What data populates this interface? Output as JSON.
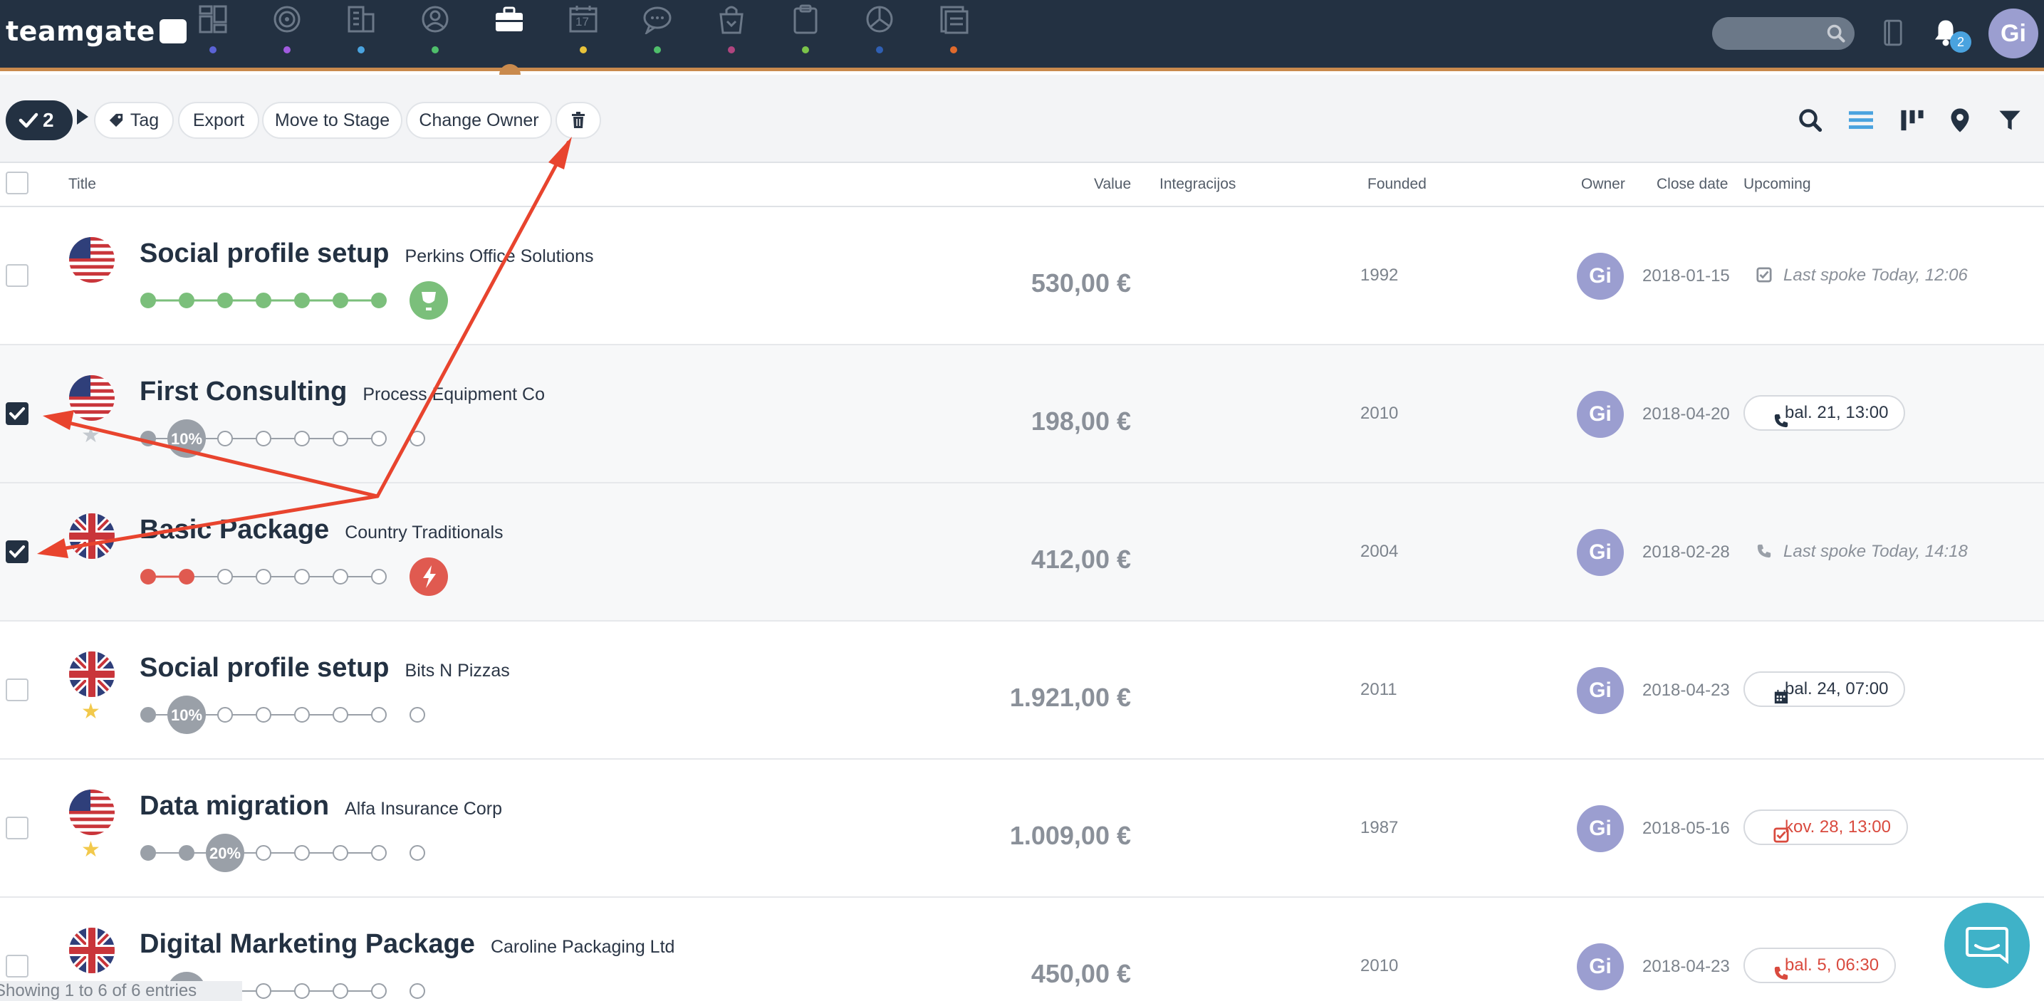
{
  "brand": {
    "logo_text": "teamgate",
    "accent_color": "#c98a4d",
    "nav_bg": "#233142"
  },
  "nav": {
    "items": [
      {
        "name": "dashboard-icon",
        "dot_color": "#5b63d6"
      },
      {
        "name": "target-icon",
        "dot_color": "#a15be0"
      },
      {
        "name": "companies-icon",
        "dot_color": "#4aa3df"
      },
      {
        "name": "people-icon",
        "dot_color": "#4fbf6b"
      },
      {
        "name": "deals-icon",
        "dot_color": "#c98a4d",
        "active": true
      },
      {
        "name": "calendar-icon",
        "dot_color": "#e8c33a"
      },
      {
        "name": "chat-icon",
        "dot_color": "#4fbf6b"
      },
      {
        "name": "shopping-bag-icon",
        "dot_color": "#b0457f"
      },
      {
        "name": "clipboard-icon",
        "dot_color": "#7bc44a"
      },
      {
        "name": "pie-chart-icon",
        "dot_color": "#2f5fb3"
      },
      {
        "name": "reports-icon",
        "dot_color": "#e06a2c"
      }
    ],
    "calendar_day": "17",
    "notification_count": "2",
    "user_initials": "Gi"
  },
  "toolbar": {
    "selected_count": "2",
    "tag_label": "Tag",
    "export_label": "Export",
    "move_label": "Move to Stage",
    "owner_label": "Change Owner"
  },
  "columns": {
    "title": "Title",
    "value": "Value",
    "integrations": "Integracijos",
    "founded": "Founded",
    "owner": "Owner",
    "close_date": "Close date",
    "upcoming": "Upcoming"
  },
  "rows": [
    {
      "title": "Social profile setup",
      "company": "Perkins Office Solutions",
      "value": "530,00 €",
      "founded": "1992",
      "owner": "Gi",
      "close_date": "2018-01-15",
      "upcoming": "Last spoke Today, 12:06",
      "upcoming_type": "task-text",
      "flag": "us",
      "checked": false,
      "star": "none",
      "pipeline": {
        "filled": 7,
        "won": true,
        "color": "#7bbf7b"
      }
    },
    {
      "title": "First Consulting",
      "company": "Process Equipment Co",
      "value": "198,00 €",
      "founded": "2010",
      "owner": "Gi",
      "close_date": "2018-04-20",
      "upcoming": "bal. 21, 13:00",
      "upcoming_type": "call",
      "flag": "us",
      "checked": true,
      "star": "grey",
      "pipeline": {
        "stage": 1,
        "percent": "10%"
      }
    },
    {
      "title": "Basic Package",
      "company": "Country Traditionals",
      "value": "412,00 €",
      "founded": "2004",
      "owner": "Gi",
      "close_date": "2018-02-28",
      "upcoming": "Last spoke Today, 14:18",
      "upcoming_type": "call-text",
      "flag": "uk",
      "checked": true,
      "star": "none",
      "pipeline": {
        "filled": 2,
        "lost": true,
        "color": "#e05a50"
      }
    },
    {
      "title": "Social profile setup",
      "company": "Bits N Pizzas",
      "value": "1.921,00 €",
      "founded": "2011",
      "owner": "Gi",
      "close_date": "2018-04-23",
      "upcoming": "bal. 24, 07:00",
      "upcoming_type": "meeting",
      "flag": "uk",
      "checked": false,
      "star": "gold",
      "pipeline": {
        "stage": 1,
        "percent": "10%"
      }
    },
    {
      "title": "Data migration",
      "company": "Alfa Insurance Corp",
      "value": "1.009,00 €",
      "founded": "1987",
      "owner": "Gi",
      "close_date": "2018-05-16",
      "upcoming": "kov. 28, 13:00",
      "upcoming_type": "task-overdue",
      "flag": "us",
      "checked": false,
      "star": "gold",
      "pipeline": {
        "stage": 2,
        "percent": "20%"
      }
    },
    {
      "title": "Digital Marketing Package",
      "company": "Caroline Packaging Ltd",
      "value": "450,00 €",
      "founded": "2010",
      "owner": "Gi",
      "close_date": "2018-04-23",
      "upcoming": "bal. 5, 06:30",
      "upcoming_type": "call-overdue",
      "flag": "uk",
      "checked": false,
      "star": "none",
      "pipeline": {
        "stage": 1,
        "percent": ""
      }
    }
  ],
  "footer": {
    "entries_info": "Showing 1 to 6 of 6 entries"
  }
}
